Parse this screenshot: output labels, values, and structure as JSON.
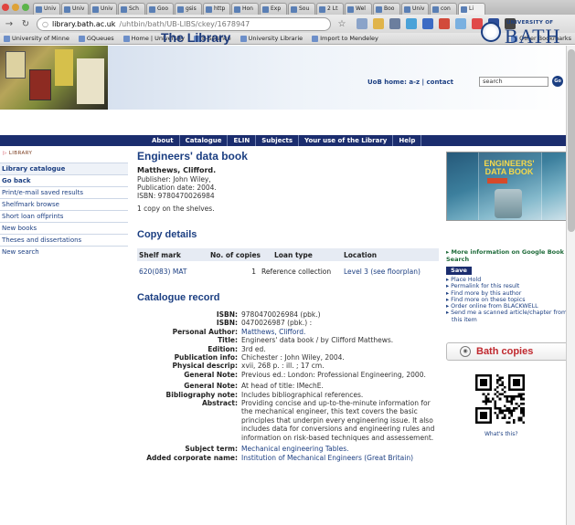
{
  "browser": {
    "tabs": [
      "Univ",
      "Univ",
      "Univ",
      "Sch",
      "Goo",
      "gsis",
      "http",
      "Hon",
      "Exp",
      "Sou",
      "2 Lt",
      "Wel",
      "Boo",
      "Univ",
      "con",
      "Li"
    ],
    "url_domain": "library.bath.ac.uk",
    "url_path": "/uhtbin/bath/UB-LIBS/ckey/1678947",
    "bookmarks": [
      "University of Minne",
      "GQueues",
      "Home | University",
      "E-Science",
      "University Librarie",
      "Import to Mendeley",
      "Other Bookmarks"
    ]
  },
  "header": {
    "title": "The Library",
    "logo_small": "UNIVERSITY OF",
    "logo_big": "BATH",
    "uob_home": "UoB home:",
    "a_z": "a-z",
    "sep": "|",
    "contact": "contact",
    "search_value": "search",
    "go": "Go"
  },
  "nav": [
    "About",
    "Catalogue",
    "ELIN",
    "Subjects",
    "Your use of the Library",
    "Help"
  ],
  "sidebar": {
    "breadcrumb": "LIBRARY",
    "items": [
      "Library catalogue",
      "Go back",
      "Print/e-mail saved results",
      "Shelfmark browse",
      "Short loan offprints",
      "New books",
      "Theses and dissertations",
      "New search"
    ]
  },
  "record": {
    "title": "Engineers' data book",
    "author": "Matthews, Clifford.",
    "publisher": "Publisher: John Wiley,",
    "pub_date": "Publication date: 2004.",
    "isbn": "ISBN: 9780470026984",
    "copies_note": "1 copy on the shelves."
  },
  "copy_details": {
    "title": "Copy details",
    "headers": [
      "Shelf mark",
      "No. of copies",
      "Loan type",
      "Location"
    ],
    "row": {
      "shelf": "620(083) MAT",
      "copies": "1",
      "loan": "Reference collection",
      "location": "Level 3 (see floorplan)"
    }
  },
  "catalogue": {
    "title": "Catalogue record",
    "rows": [
      {
        "label": "ISBN:",
        "value": "9780470026984 (pbk.)"
      },
      {
        "label": "ISBN:",
        "value": "0470026987 (pbk.) :"
      },
      {
        "label": "Personal Author:",
        "value": "Matthews, Clifford.",
        "link": true
      },
      {
        "label": "Title:",
        "value": "Engineers' data book / by Clifford Matthews."
      },
      {
        "label": "Edition:",
        "value": "3rd ed."
      },
      {
        "label": "Publication info:",
        "value": "Chichester : John Wiley, 2004."
      },
      {
        "label": "Physical descrip:",
        "value": "xvii, 268 p. : ill. ; 17 cm."
      },
      {
        "label": "General Note:",
        "value": "Previous ed.: London: Professional Engineering, 2000."
      },
      {
        "label": "General Note:",
        "value": "At head of title: IMechE."
      },
      {
        "label": "Bibliography note:",
        "value": "Includes bibliographical references."
      },
      {
        "label": "Abstract:",
        "value": "Providing concise and up-to-the-minute information for the mechanical engineer, this text covers the basic principles that underpin every engineering issue. It also includes data for conversions and engineering rules and information on risk-based techniques and assessement."
      },
      {
        "label": "Subject term:",
        "value": "Mechanical engineering Tables.",
        "link": true
      },
      {
        "label": "Added corporate name:",
        "value": "Institution of Mechanical Engineers (Great Britain)",
        "link": true
      }
    ]
  },
  "right": {
    "cover_title": "ENGINEERS' DATA BOOK",
    "more_info": "More information on Google Book Search",
    "save_label": "Save",
    "save_items": [
      "Place Hold",
      "Permalink for this result",
      "Find more by this author",
      "Find more on these topics",
      "Order online from BLACKWELL",
      "Send me a scanned article/chapter from this item"
    ],
    "bath_copies": "Bath copies",
    "whats_this": "What's this?"
  },
  "colors": {
    "brand_blue": "#1c3f82",
    "nav_bg": "#1b2d6e",
    "bath_copies_red": "#c0282e"
  }
}
